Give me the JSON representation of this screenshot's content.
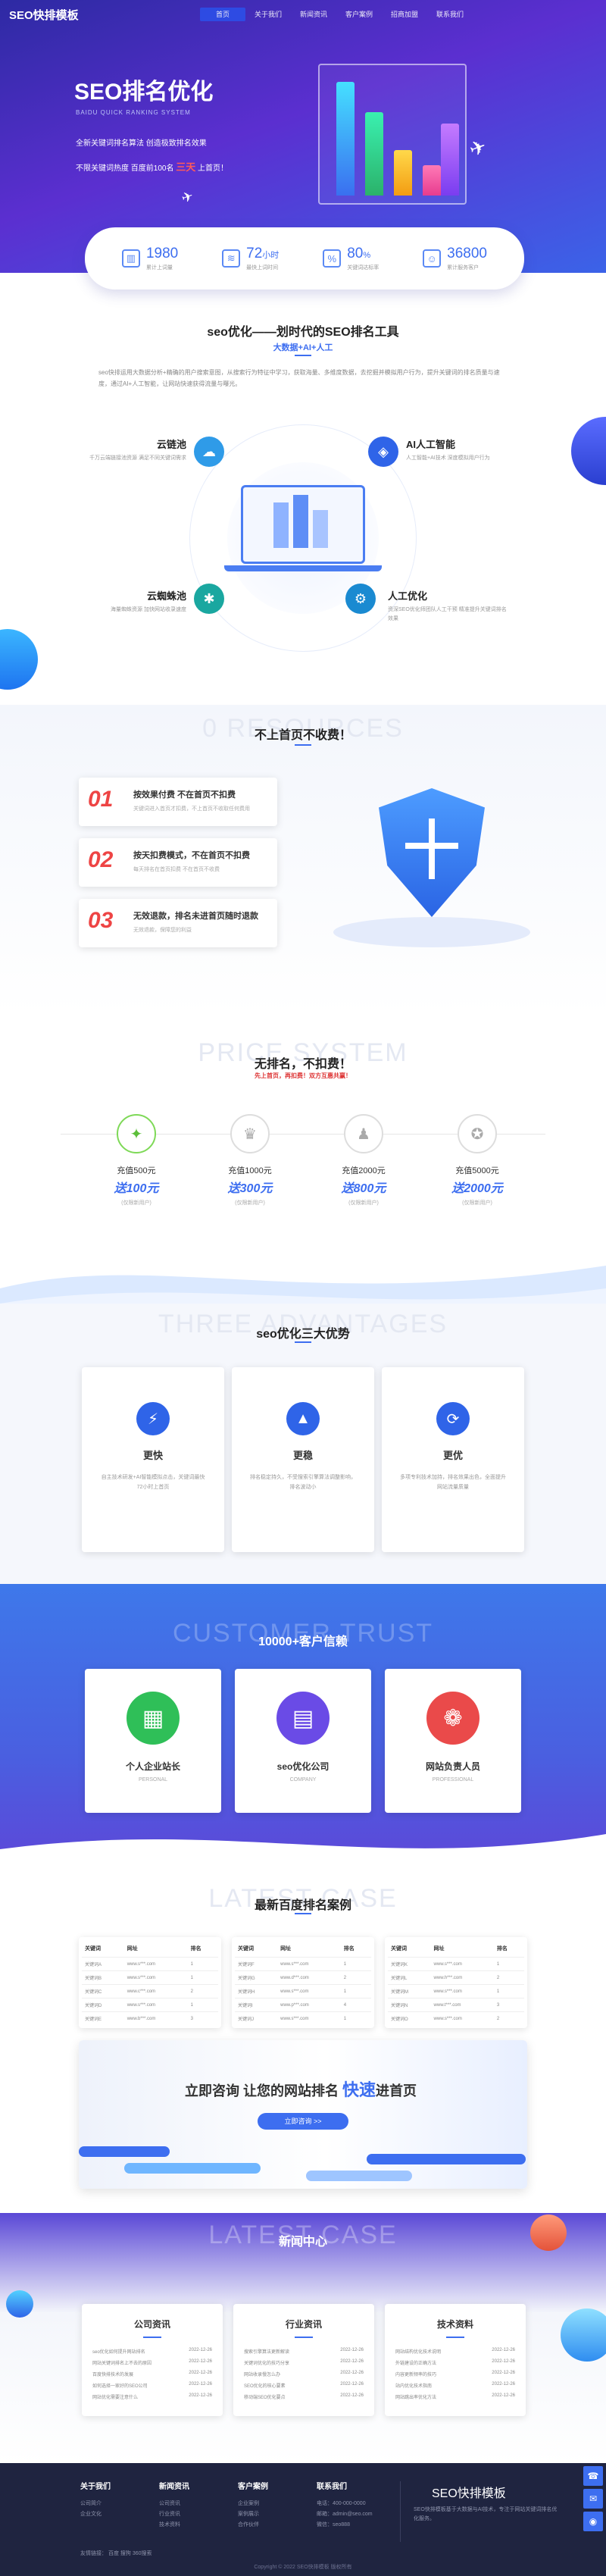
{
  "header": {
    "logo": "SEO快排模板",
    "nav": [
      "首页",
      "关于我们",
      "新闻资讯",
      "客户案例",
      "招商加盟",
      "联系我们"
    ]
  },
  "hero": {
    "title": "SEO排名优化",
    "subtitle": "BAIDU QUICK RANKING SYSTEM",
    "line1": "全新关键词排名算法 创造极致排名效果",
    "line2_a": "不限关键词热度 百度前100名",
    "line2_b": "三天",
    "line2_c": "上首页！"
  },
  "stats": [
    {
      "icon": "bar-chart-icon",
      "num": "1980",
      "unit": "",
      "label": "累计上词量"
    },
    {
      "icon": "stack-icon",
      "num": "72",
      "unit": "小时",
      "label": "最快上词时间"
    },
    {
      "icon": "percent-icon",
      "num": "80",
      "unit": "%",
      "label": "关键词达标率"
    },
    {
      "icon": "users-icon",
      "num": "36800",
      "unit": "",
      "label": "累计服务客户"
    }
  ],
  "intro": {
    "title": "seo优化——划时代的SEO排名工具",
    "tag": "大数据+AI+人工",
    "para": "seo快排运用大数据分析+精确的用户搜索意图，从搜索行为特征中学习，获取海量、多维度数据，去挖掘并模拟用户行为，提升关键词的排名质量与速度，通过AI+人工智能，让网站快速获得流量与曝光。",
    "features": [
      {
        "title": "云链池",
        "desc": "千万云端链接池资源 满足不同关键词需求"
      },
      {
        "title": "AI人工智能",
        "desc": "人工智能+AI技术 深度模拟用户行为"
      },
      {
        "title": "云蜘蛛池",
        "desc": "海量蜘蛛资源 加快网站收录速度"
      },
      {
        "title": "人工优化",
        "desc": "资深SEO优化师团队人工干预 精准提升关键词排名效果"
      }
    ]
  },
  "notop": {
    "bg": "0 RESOURCES",
    "title": "不上首页不收费！",
    "items": [
      {
        "n": "01",
        "t": "按效果付费 不在首页不扣费",
        "s": "关键词进入首页才扣费，不上首页不收取任何费用"
      },
      {
        "n": "02",
        "t": "按天扣费模式，不在首页不扣费",
        "s": "每天排名在首页扣费 不在首页不收费"
      },
      {
        "n": "03",
        "t": "无效退款，排名未进首页随时退款",
        "s": "无效退款，保障您的利益"
      }
    ]
  },
  "price": {
    "bg": "PRICE SYSTEM",
    "title": "无排名，不扣费！",
    "sub": "先上首页，再扣费！双方互惠共赢！",
    "items": [
      {
        "icon": "lightbulb-icon",
        "a": "充值500元",
        "b": "送100元",
        "c": "(仅限新用户)"
      },
      {
        "icon": "crown-icon",
        "a": "充值1000元",
        "b": "送300元",
        "c": "(仅限新用户)"
      },
      {
        "icon": "person-icon",
        "a": "充值2000元",
        "b": "送800元",
        "c": "(仅限新用户)"
      },
      {
        "icon": "medal-icon",
        "a": "充值5000元",
        "b": "送2000元",
        "c": "(仅限新用户)"
      }
    ]
  },
  "adv": {
    "bg": "THREE ADVANTAGES",
    "title": "seo优化三大优势",
    "items": [
      {
        "icon": "lightning-icon",
        "t": "更快",
        "d": "自主技术研发+AI智能模拟点击，关键词最快72小时上首页"
      },
      {
        "icon": "chart-up-icon",
        "t": "更稳",
        "d": "排名稳定持久，不受搜索引擎算法调整影响，排名波动小"
      },
      {
        "icon": "refresh-icon",
        "t": "更优",
        "d": "多项专利技术加持，排名效果出色，全面提升网站流量质量"
      }
    ]
  },
  "trust": {
    "bg": "CUSTOMER TRUST",
    "title": "10000+客户信赖",
    "items": [
      {
        "icon": "building-icon",
        "t": "个人企业站长",
        "s": "PERSONAL"
      },
      {
        "icon": "document-icon",
        "t": "seo优化公司",
        "s": "COMPANY"
      },
      {
        "icon": "group-icon",
        "t": "网站负责人员",
        "s": "PROFESSIONAL"
      }
    ]
  },
  "cases": {
    "bg": "LATEST CASE",
    "title": "最新百度排名案例",
    "headers": [
      "关键词",
      "网址",
      "排名"
    ],
    "tables": [
      [
        [
          "关键词A",
          "www.s***.com",
          "1"
        ],
        [
          "关键词B",
          "www.s***.com",
          "1"
        ],
        [
          "关键词C",
          "www.c***.com",
          "2"
        ],
        [
          "关键词D",
          "www.s***.com",
          "1"
        ],
        [
          "关键词E",
          "www.b***.com",
          "3"
        ]
      ],
      [
        [
          "关键词F",
          "www.s***.com",
          "1"
        ],
        [
          "关键词G",
          "www.d***.com",
          "2"
        ],
        [
          "关键词H",
          "www.s***.com",
          "1"
        ],
        [
          "关键词I",
          "www.p***.com",
          "4"
        ],
        [
          "关键词J",
          "www.s***.com",
          "1"
        ]
      ],
      [
        [
          "关键词K",
          "www.s***.com",
          "1"
        ],
        [
          "关键词L",
          "www.h***.com",
          "2"
        ],
        [
          "关键词M",
          "www.s***.com",
          "1"
        ],
        [
          "关键词N",
          "www.t***.com",
          "3"
        ],
        [
          "关键词O",
          "www.s***.com",
          "2"
        ]
      ]
    ],
    "banner_a": "立即咨询 让您的网站排名",
    "banner_b": "快速",
    "banner_c": "进首页",
    "banner_btn": "立即咨询 >>"
  },
  "news": {
    "bg": "LATEST CASE",
    "title": "新闻中心",
    "cols": [
      {
        "t": "公司资讯",
        "items": [
          [
            "seo优化如何提升网站排名",
            "2022-12-26"
          ],
          [
            "网站关键词排名上不去的原因",
            "2022-12-26"
          ],
          [
            "百度快排技术的发展",
            "2022-12-26"
          ],
          [
            "如何选择一家好的SEO公司",
            "2022-12-26"
          ],
          [
            "网站优化需要注意什么",
            "2022-12-26"
          ]
        ]
      },
      {
        "t": "行业资讯",
        "items": [
          [
            "搜索引擎算法更新解读",
            "2022-12-26"
          ],
          [
            "关键词优化的技巧分享",
            "2022-12-26"
          ],
          [
            "网站收录慢怎么办",
            "2022-12-26"
          ],
          [
            "SEO优化的核心要素",
            "2022-12-26"
          ],
          [
            "移动端SEO优化要点",
            "2022-12-26"
          ]
        ]
      },
      {
        "t": "技术资料",
        "items": [
          [
            "网站结构优化技术说明",
            "2022-12-26"
          ],
          [
            "外链建设的正确方法",
            "2022-12-26"
          ],
          [
            "内容更新频率的技巧",
            "2022-12-26"
          ],
          [
            "站内优化技术指南",
            "2022-12-26"
          ],
          [
            "网站跳出率优化方法",
            "2022-12-26"
          ]
        ]
      }
    ]
  },
  "footer": {
    "cols": [
      {
        "h": "关于我们",
        "l": [
          "公司简介",
          "企业文化"
        ]
      },
      {
        "h": "新闻资讯",
        "l": [
          "公司资讯",
          "行业资讯",
          "技术资料"
        ]
      },
      {
        "h": "客户案例",
        "l": [
          "企业案例",
          "案例展示",
          "合作伙伴"
        ]
      },
      {
        "h": "联系我们",
        "l": [
          "电话：400-000-0000",
          "邮箱：admin@seo.com",
          "微信：seo888"
        ]
      }
    ],
    "brand": "SEO快排模板",
    "brand_desc": "SEO快排模板基于大数据与AI技术，专注于网站关键词排名优化服务。",
    "links": "友情链接：  百度  搜狗  360搜索",
    "copy": "Copyright © 2022 SEO快排模板 版权所有"
  },
  "colors": {
    "primary": "#3d6ef0",
    "accent": "#e44",
    "purple": "#5b2fd0"
  }
}
